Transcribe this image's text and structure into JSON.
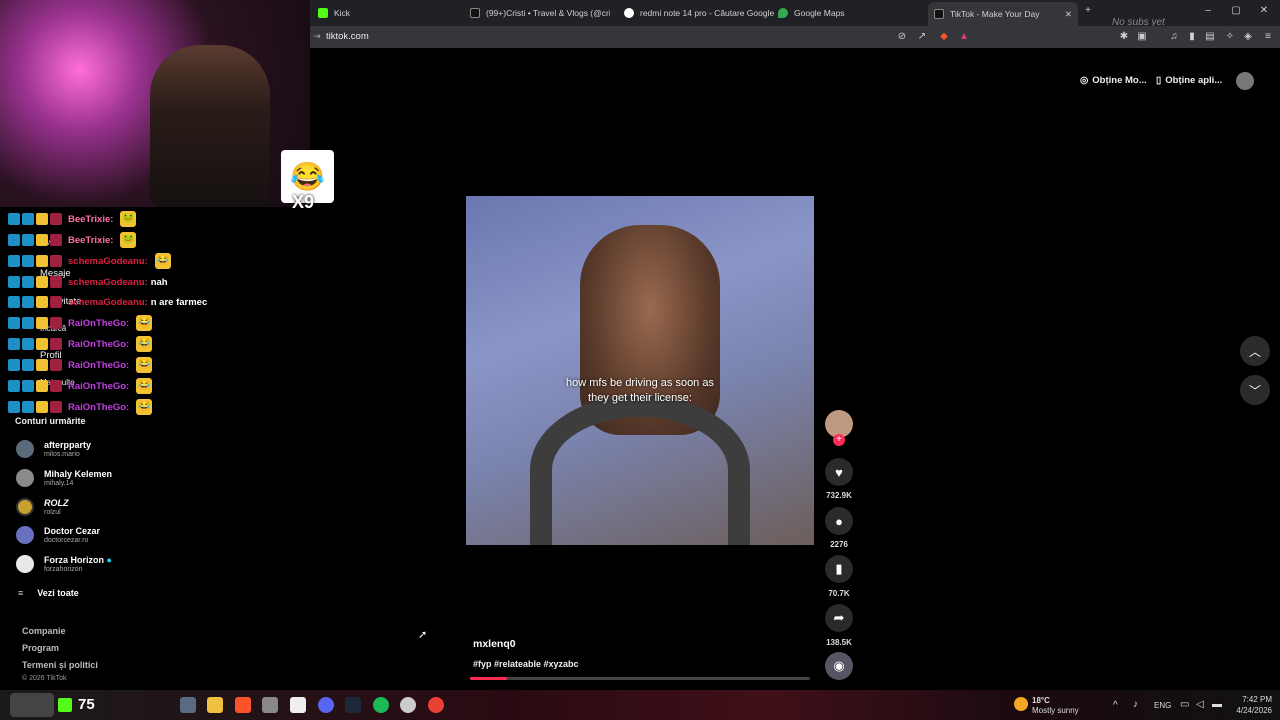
{
  "browser": {
    "tabs": [
      {
        "label": "Kick",
        "color": "#53fc18"
      },
      {
        "label": "(99+)Cristi • Travel & Vlogs (@cristi...",
        "color": "#111111"
      },
      {
        "label": "redmi note 14 pro - Căutare Google",
        "color": "#ffffff"
      },
      {
        "label": "Google Maps",
        "color": "#34a853"
      },
      {
        "label": "TikTok - Make Your Day",
        "color": "#111111"
      }
    ],
    "url": "tiktok.com",
    "overlay_text": "No subs yet"
  },
  "overlay": {
    "emote_count": "X9",
    "chat": [
      {
        "name": "BeeTrixie:",
        "color": "#ff6fa8",
        "msg": ""
      },
      {
        "name": "BeeTrixie:",
        "color": "#ff6fa8",
        "msg": ""
      },
      {
        "name": "schemaGodeanu:",
        "color": "#e0203f",
        "msg": ""
      },
      {
        "name": "schemaGodeanu:",
        "color": "#e0203f",
        "msg": "nah"
      },
      {
        "name": "schemaGodeanu:",
        "color": "#e0203f",
        "msg": "n are farmec"
      },
      {
        "name": "RaiOnTheGo:",
        "color": "#c040e0",
        "msg": ""
      },
      {
        "name": "RaiOnTheGo:",
        "color": "#c040e0",
        "msg": ""
      },
      {
        "name": "RaiOnTheGo:",
        "color": "#c040e0",
        "msg": ""
      },
      {
        "name": "RaiOnTheGo:",
        "color": "#c040e0",
        "msg": ""
      },
      {
        "name": "RaiOnTheGo:",
        "color": "#c040e0",
        "msg": ""
      }
    ]
  },
  "sidebar": {
    "behind_overlay": [
      "LIVE",
      "Mesaje",
      "tivitate",
      "Încarcă",
      "Profil",
      "Mai multe"
    ],
    "following_title": "Conturi urmărite",
    "accounts": [
      {
        "name": "afterpparty",
        "handle": "milos.mario"
      },
      {
        "name": "Mihaly Kelemen",
        "handle": "mihaly.14"
      },
      {
        "name": "ROLZ",
        "handle": "rolzul"
      },
      {
        "name": "Doctor Cezar",
        "handle": "doctorcezar.ro"
      },
      {
        "name": "Forza Horizon",
        "handle": "forzahorizon"
      }
    ],
    "see_all": "Vezi toate",
    "footer": [
      "Companie",
      "Program",
      "Termeni și politici"
    ],
    "copyright": "© 2026 TikTok"
  },
  "top_actions": {
    "get_coins": "Obține Mo...",
    "get_app": "Obține apli..."
  },
  "video": {
    "caption": "how mfs be driving as soon as they get their license:",
    "author": "mxlenq0",
    "tags": "#fyp #relateable #xyzabc",
    "progress": 0.11,
    "likes": "732.9K",
    "comments": "2276",
    "saves": "70.7K",
    "shares": "138.5K"
  },
  "taskbar": {
    "viewer_count": "75",
    "weather_temp": "18°C",
    "weather_desc": "Mostly sunny",
    "lang": "ENG",
    "time": "7:42 PM",
    "date": "4/24/2026"
  }
}
